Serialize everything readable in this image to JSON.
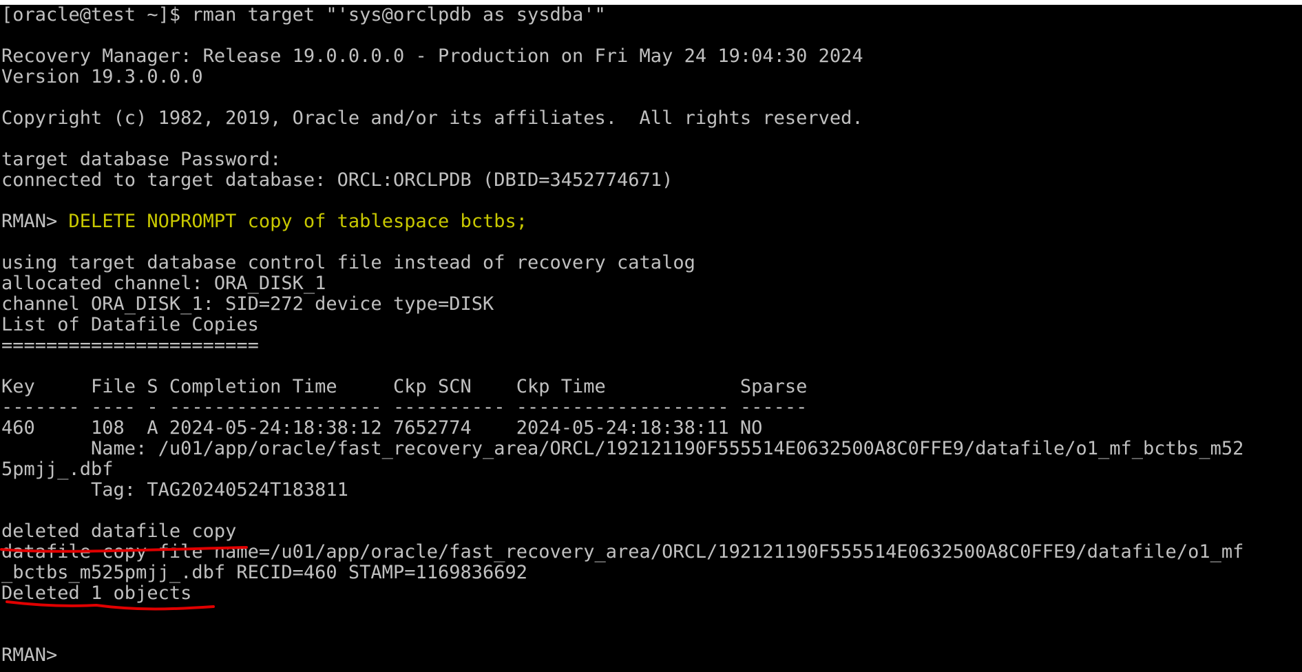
{
  "colors": {
    "background": "#000000",
    "text": "#c0c0c0",
    "highlight": "#c8c800",
    "annotation": "#e00000"
  },
  "terminal": {
    "l1_prompt": "[oracle@test ~]$ ",
    "l1_cmd": "rman target \"'sys@orclpdb as sysdba'\"",
    "l3": "Recovery Manager: Release 19.0.0.0.0 - Production on Fri May 24 19:04:30 2024",
    "l4": "Version 19.3.0.0.0",
    "l6": "Copyright (c) 1982, 2019, Oracle and/or its affiliates.  All rights reserved.",
    "l8": "target database Password:",
    "l9": "connected to target database: ORCL:ORCLPDB (DBID=3452774671)",
    "l11_prompt": "RMAN> ",
    "l11_cmd": "DELETE NOPROMPT copy of tablespace bctbs;",
    "l13": "using target database control file instead of recovery catalog",
    "l14": "allocated channel: ORA_DISK_1",
    "l15": "channel ORA_DISK_1: SID=272 device type=DISK",
    "l16": "List of Datafile Copies",
    "l17": "=======================",
    "l19": "Key     File S Completion Time     Ckp SCN    Ckp Time            Sparse",
    "l20": "------- ---- - ------------------- ---------- ------------------- ------",
    "l21": "460     108  A 2024-05-24:18:38:12 7652774    2024-05-24:18:38:11 NO",
    "l22": "        Name: /u01/app/oracle/fast_recovery_area/ORCL/192121190F555514E0632500A8C0FFE9/datafile/o1_mf_bctbs_m52",
    "l23": "5pmjj_.dbf",
    "l24": "        Tag: TAG20240524T183811",
    "l26": "deleted datafile copy",
    "l27": "datafile copy file name=/u01/app/oracle/fast_recovery_area/ORCL/192121190F555514E0632500A8C0FFE9/datafile/o1_mf",
    "l28": "_bctbs_m525pmjj_.dbf RECID=460 STAMP=1169836692",
    "l29": "Deleted 1 objects",
    "l32": "RMAN> "
  }
}
